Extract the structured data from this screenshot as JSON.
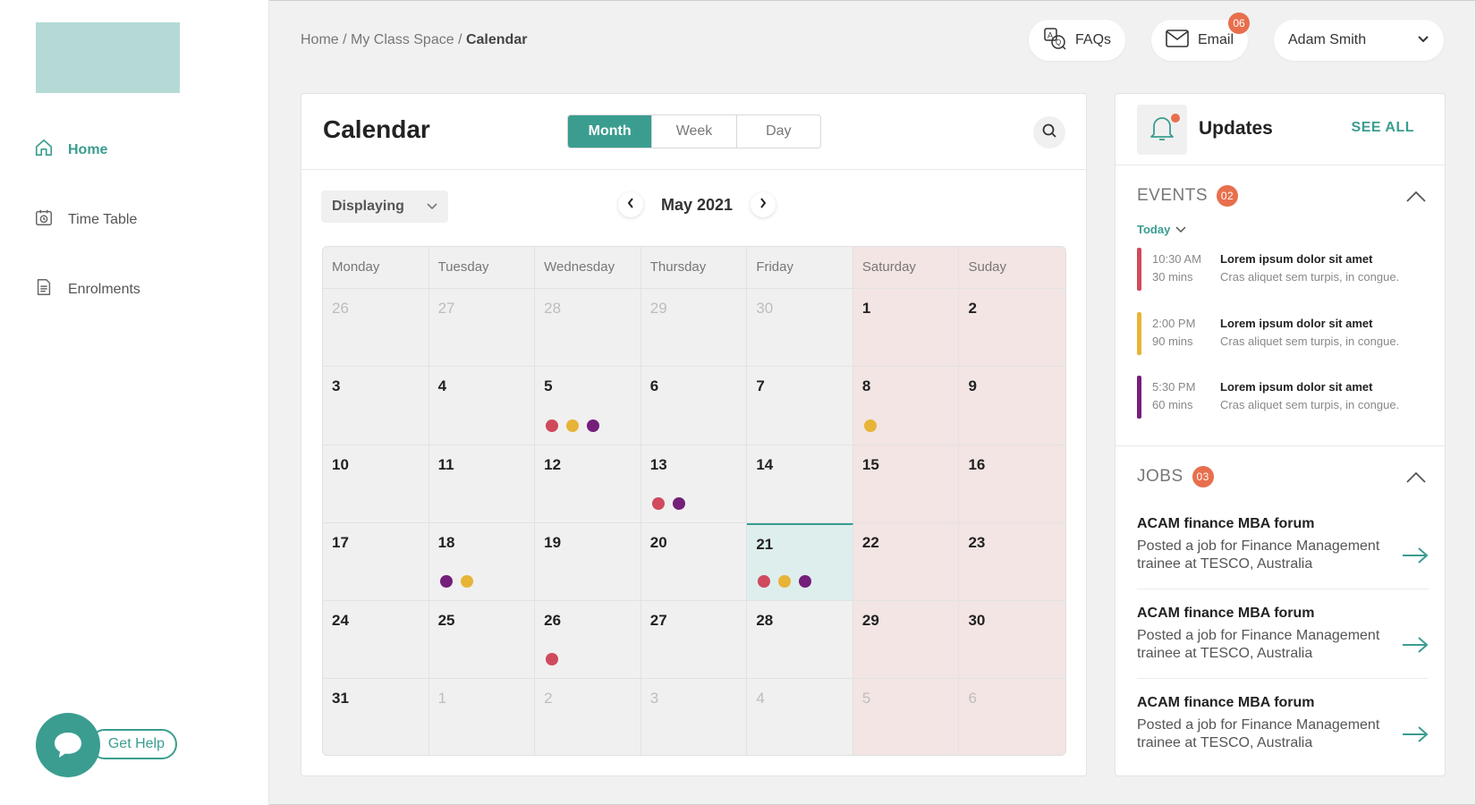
{
  "breadcrumb": {
    "part1": "Home",
    "sep1": " / ",
    "part2": "My Class Space",
    "sep2": " / ",
    "current": "Calendar"
  },
  "sidebar": {
    "items": [
      {
        "label": "Home",
        "icon": "home-icon",
        "active": true
      },
      {
        "label": "Time Table",
        "icon": "timetable-icon",
        "active": false
      },
      {
        "label": "Enrolments",
        "icon": "document-icon",
        "active": false
      }
    ],
    "help_label": "Get Help"
  },
  "topbar": {
    "faqs_label": "FAQs",
    "email_label": "Email",
    "email_badge": "06",
    "user_name": "Adam Smith"
  },
  "calendar": {
    "title": "Calendar",
    "views": [
      "Month",
      "Week",
      "Day"
    ],
    "active_view": "Month",
    "display_label": "Displaying",
    "month_label": "May 2021",
    "weekdays": [
      "Monday",
      "Tuesday",
      "Wednesday",
      "Thursday",
      "Friday",
      "Saturday",
      "Suday"
    ],
    "weeks": [
      [
        {
          "d": "26",
          "m": true
        },
        {
          "d": "27",
          "m": true
        },
        {
          "d": "28",
          "m": true
        },
        {
          "d": "29",
          "m": true
        },
        {
          "d": "30",
          "m": true
        },
        {
          "d": "1"
        },
        {
          "d": "2"
        }
      ],
      [
        {
          "d": "3"
        },
        {
          "d": "4"
        },
        {
          "d": "5",
          "dots": [
            "red",
            "yellow",
            "purple"
          ]
        },
        {
          "d": "6"
        },
        {
          "d": "7"
        },
        {
          "d": "8",
          "dots": [
            "yellow"
          ]
        },
        {
          "d": "9"
        }
      ],
      [
        {
          "d": "10"
        },
        {
          "d": "11"
        },
        {
          "d": "12"
        },
        {
          "d": "13",
          "dots": [
            "red",
            "purple"
          ]
        },
        {
          "d": "14"
        },
        {
          "d": "15"
        },
        {
          "d": "16"
        }
      ],
      [
        {
          "d": "17"
        },
        {
          "d": "18",
          "dots": [
            "purple",
            "yellow"
          ]
        },
        {
          "d": "19"
        },
        {
          "d": "20"
        },
        {
          "d": "21",
          "today": true,
          "dots": [
            "red",
            "yellow",
            "purple"
          ]
        },
        {
          "d": "22"
        },
        {
          "d": "23"
        }
      ],
      [
        {
          "d": "24"
        },
        {
          "d": "25"
        },
        {
          "d": "26",
          "dots": [
            "red"
          ]
        },
        {
          "d": "27"
        },
        {
          "d": "28"
        },
        {
          "d": "29"
        },
        {
          "d": "30"
        }
      ],
      [
        {
          "d": "31"
        },
        {
          "d": "1",
          "m": true
        },
        {
          "d": "2",
          "m": true
        },
        {
          "d": "3",
          "m": true
        },
        {
          "d": "4",
          "m": true
        },
        {
          "d": "5",
          "m": true
        },
        {
          "d": "6",
          "m": true
        }
      ]
    ]
  },
  "colors": {
    "accent": "#3a9d90",
    "badge": "#e86f4d",
    "red": "#cf4a5c",
    "yellow": "#e7b437",
    "purple": "#741f7a",
    "weekend": "#f2e5e3",
    "today": "#deeeed"
  },
  "updates": {
    "title": "Updates",
    "see_all": "SEE ALL",
    "events_label": "EVENTS",
    "events_count": "02",
    "filter_label": "Today",
    "events": [
      {
        "time": "10:30 AM",
        "duration": "30 mins",
        "title": "Lorem ipsum dolor sit amet",
        "desc": "Cras aliquet sem turpis, in congue.",
        "color": "red"
      },
      {
        "time": "2:00 PM",
        "duration": "90 mins",
        "title": "Lorem ipsum dolor sit amet",
        "desc": "Cras aliquet sem turpis, in congue.",
        "color": "yellow"
      },
      {
        "time": "5:30 PM",
        "duration": "60 mins",
        "title": "Lorem ipsum dolor sit amet",
        "desc": "Cras aliquet sem turpis, in congue.",
        "color": "purple"
      }
    ],
    "jobs_label": "JOBS",
    "jobs_count": "03",
    "jobs": [
      {
        "title": "ACAM finance MBA forum",
        "desc": "Posted a job for Finance Management trainee at TESCO, Australia"
      },
      {
        "title": "ACAM finance MBA forum",
        "desc": "Posted a job for Finance Management trainee at TESCO, Australia"
      },
      {
        "title": "ACAM finance MBA forum",
        "desc": "Posted a job for Finance Management trainee at TESCO, Australia"
      }
    ]
  }
}
